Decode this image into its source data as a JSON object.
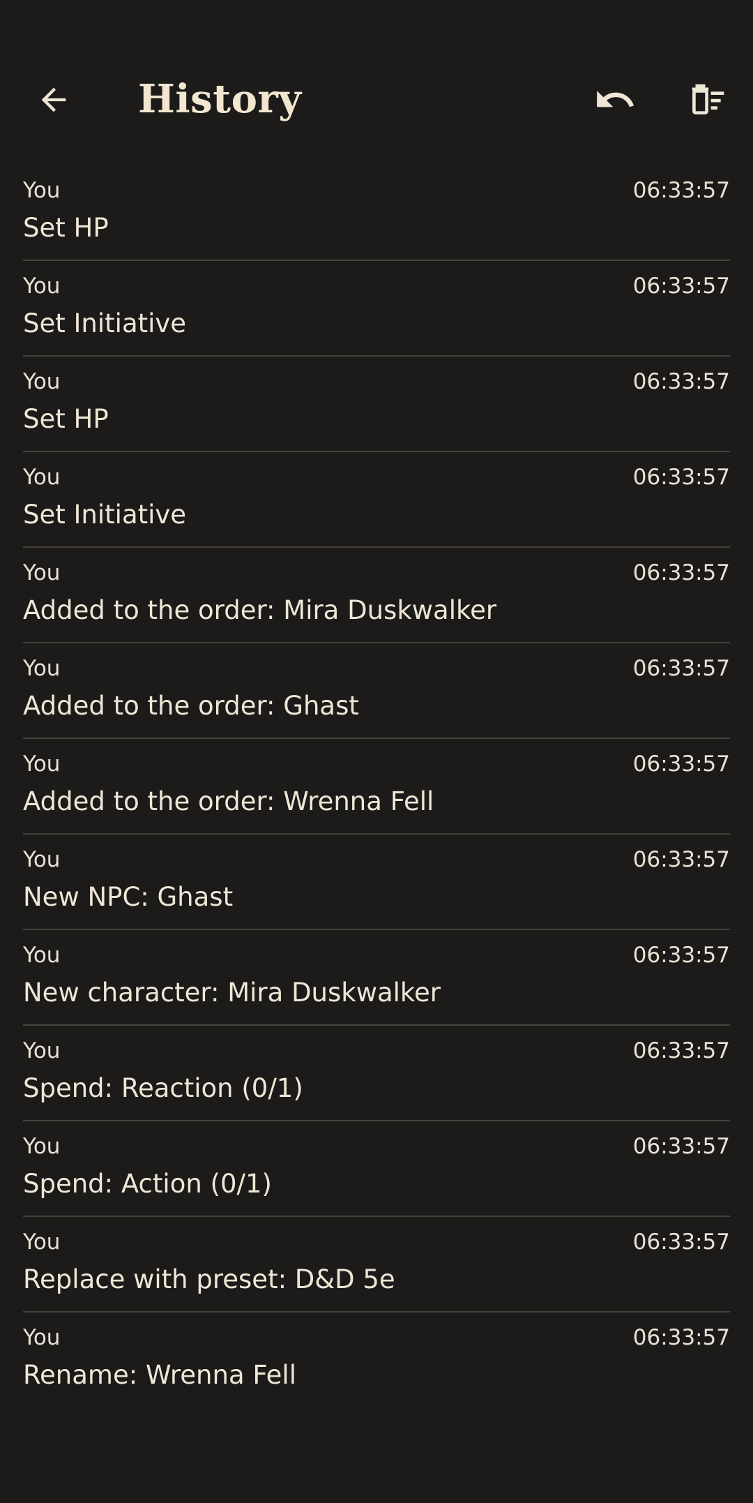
{
  "header": {
    "title": "History",
    "back_icon": "arrow-back-icon",
    "undo_icon": "undo-icon",
    "clear_icon": "clear-history-icon"
  },
  "history": [
    {
      "actor": "You",
      "time": "06:33:57",
      "text": "Set HP"
    },
    {
      "actor": "You",
      "time": "06:33:57",
      "text": "Set Initiative"
    },
    {
      "actor": "You",
      "time": "06:33:57",
      "text": "Set HP"
    },
    {
      "actor": "You",
      "time": "06:33:57",
      "text": "Set Initiative"
    },
    {
      "actor": "You",
      "time": "06:33:57",
      "text": "Added to the order: Mira Duskwalker"
    },
    {
      "actor": "You",
      "time": "06:33:57",
      "text": "Added to the order: Ghast"
    },
    {
      "actor": "You",
      "time": "06:33:57",
      "text": "Added to the order: Wrenna Fell"
    },
    {
      "actor": "You",
      "time": "06:33:57",
      "text": "New NPC: Ghast"
    },
    {
      "actor": "You",
      "time": "06:33:57",
      "text": "New character: Mira Duskwalker"
    },
    {
      "actor": "You",
      "time": "06:33:57",
      "text": "Spend: Reaction (0/1)"
    },
    {
      "actor": "You",
      "time": "06:33:57",
      "text": "Spend: Action (0/1)"
    },
    {
      "actor": "You",
      "time": "06:33:57",
      "text": "Replace with preset: D&D 5e"
    },
    {
      "actor": "You",
      "time": "06:33:57",
      "text": "Rename: Wrenna Fell"
    }
  ],
  "colors": {
    "background": "#1c1b1a",
    "text": "#efe6d6",
    "divider": "#45423e"
  }
}
